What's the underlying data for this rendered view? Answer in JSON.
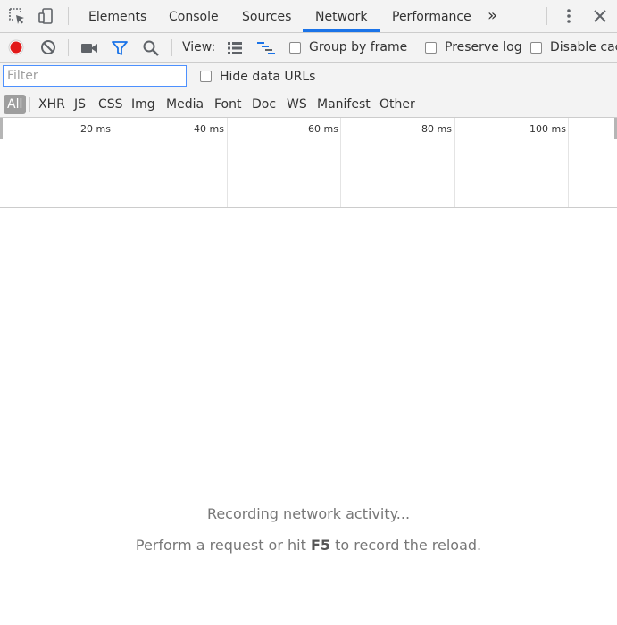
{
  "tabs": {
    "items": [
      {
        "label": "Elements"
      },
      {
        "label": "Console"
      },
      {
        "label": "Sources"
      },
      {
        "label": "Network"
      },
      {
        "label": "Performance"
      }
    ],
    "more": "»",
    "active": "Network"
  },
  "toolbar": {
    "view_label": "View:",
    "group_by_frame": "Group by frame",
    "preserve_log": "Preserve log",
    "disable_cache": "Disable cac"
  },
  "filter": {
    "placeholder": "Filter",
    "hide_data_urls": "Hide data URLs"
  },
  "types": [
    "All",
    "XHR",
    "JS",
    "CSS",
    "Img",
    "Media",
    "Font",
    "Doc",
    "WS",
    "Manifest",
    "Other"
  ],
  "timeline": {
    "ticks": [
      "20 ms",
      "40 ms",
      "60 ms",
      "80 ms",
      "100 ms"
    ]
  },
  "empty": {
    "title": "Recording network activity...",
    "hint_prefix": "Perform a request or hit ",
    "hint_key": "F5",
    "hint_suffix": " to record the reload."
  },
  "colors": {
    "record": "#e21a1a",
    "accent": "#1a73e8",
    "filter_icon": "#1a73e8"
  }
}
